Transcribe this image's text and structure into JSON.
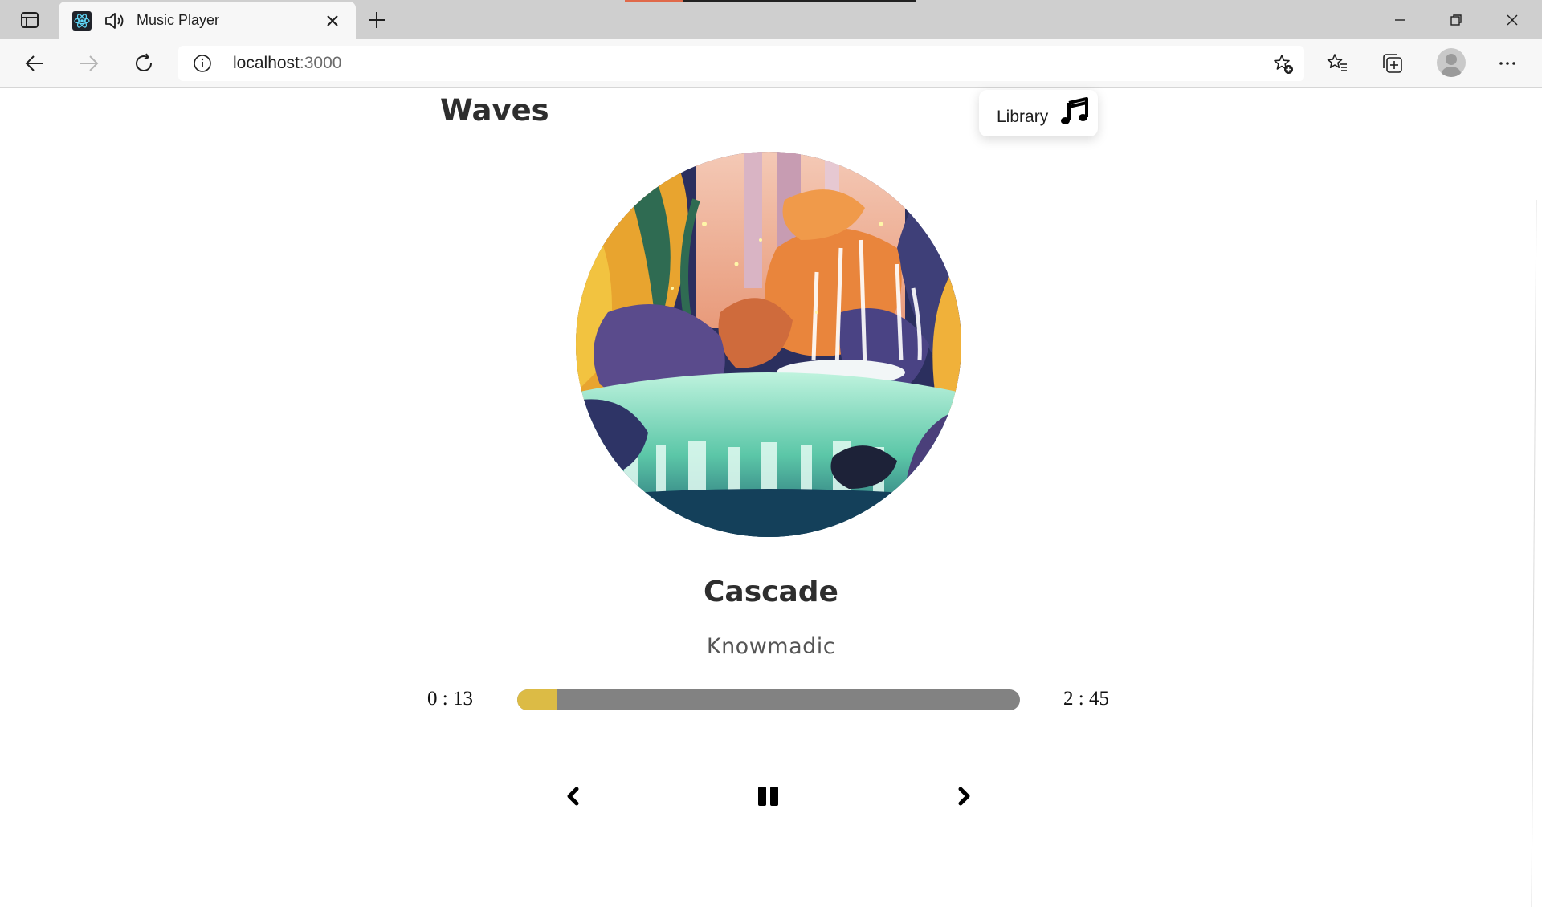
{
  "browser": {
    "tab_title": "Music Player",
    "address": {
      "host": "localhost",
      "port": ":3000"
    },
    "icons": {
      "tab_panel": "tab-panel-icon",
      "favicon": "react-logo-icon",
      "audio": "speaker-icon",
      "close_tab": "close-icon",
      "new_tab": "plus-icon",
      "back": "back-arrow-icon",
      "forward": "forward-arrow-icon",
      "refresh": "refresh-icon",
      "site_info": "info-icon",
      "add_favorite": "star-plus-icon",
      "favorites": "favorites-icon",
      "collections": "collections-icon",
      "profile": "profile-icon",
      "menu": "more-icon"
    }
  },
  "app": {
    "logo": "Waves",
    "library_button": {
      "label": "Library",
      "icon": "music-note-icon"
    },
    "song": {
      "title": "Cascade",
      "artist": "Knowmadic",
      "cover_icon": "album-art-waterfall"
    },
    "player": {
      "current_time": "0 : 13",
      "total_time": "2 : 45",
      "progress_fraction": 0.079,
      "track_color": "#828282",
      "fill_color": "#dcbb45",
      "controls": {
        "previous": "chevron-left-icon",
        "play_pause": "pause-icon",
        "next": "chevron-right-icon"
      }
    }
  }
}
